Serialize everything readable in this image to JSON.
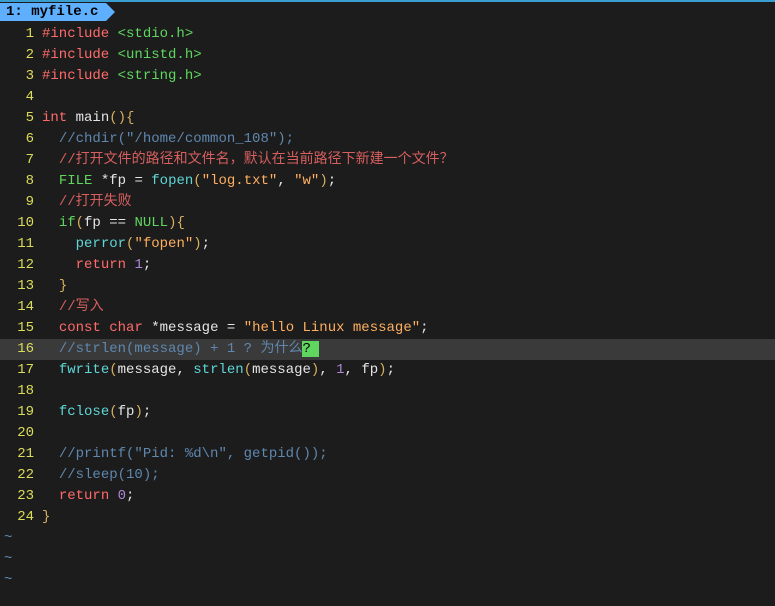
{
  "tab": {
    "label": " 1: myfile.c "
  },
  "lines": [
    {
      "n": 1,
      "tokens": [
        [
          "pp",
          "#include "
        ],
        [
          "hdr",
          "<stdio.h>"
        ]
      ]
    },
    {
      "n": 2,
      "tokens": [
        [
          "pp",
          "#include "
        ],
        [
          "hdr",
          "<unistd.h>"
        ]
      ]
    },
    {
      "n": 3,
      "tokens": [
        [
          "pp",
          "#include "
        ],
        [
          "hdr",
          "<string.h>"
        ]
      ]
    },
    {
      "n": 4,
      "tokens": []
    },
    {
      "n": 5,
      "tokens": [
        [
          "kw",
          "int"
        ],
        [
          "id",
          " main"
        ],
        [
          "pn",
          "(){"
        ]
      ]
    },
    {
      "n": 6,
      "tokens": [
        [
          "id",
          "  "
        ],
        [
          "cm",
          "//chdir(\"/home/common_108\");"
        ]
      ]
    },
    {
      "n": 7,
      "tokens": [
        [
          "id",
          "  "
        ],
        [
          "cmcn",
          "//打开文件的路径和文件名，默认在当前路径下新建一个文件？"
        ]
      ]
    },
    {
      "n": 8,
      "tokens": [
        [
          "id",
          "  "
        ],
        [
          "ty",
          "FILE"
        ],
        [
          "id",
          " "
        ],
        [
          "op",
          "*"
        ],
        [
          "id",
          "fp "
        ],
        [
          "op",
          "="
        ],
        [
          "id",
          " "
        ],
        [
          "fn",
          "fopen"
        ],
        [
          "pn",
          "("
        ],
        [
          "str",
          "\"log.txt\""
        ],
        [
          "op",
          ", "
        ],
        [
          "str",
          "\"w\""
        ],
        [
          "pn",
          ")"
        ],
        [
          "op",
          ";"
        ]
      ]
    },
    {
      "n": 9,
      "tokens": [
        [
          "id",
          "  "
        ],
        [
          "cmcn",
          "//打开失败"
        ]
      ]
    },
    {
      "n": 10,
      "tokens": [
        [
          "id",
          "  "
        ],
        [
          "kwg",
          "if"
        ],
        [
          "pn",
          "("
        ],
        [
          "id",
          "fp "
        ],
        [
          "op",
          "=="
        ],
        [
          "id",
          " "
        ],
        [
          "ty",
          "NULL"
        ],
        [
          "pn",
          "){"
        ]
      ]
    },
    {
      "n": 11,
      "tokens": [
        [
          "id",
          "    "
        ],
        [
          "fn",
          "perror"
        ],
        [
          "pn",
          "("
        ],
        [
          "str",
          "\"fopen\""
        ],
        [
          "pn",
          ")"
        ],
        [
          "op",
          ";"
        ]
      ]
    },
    {
      "n": 12,
      "tokens": [
        [
          "id",
          "    "
        ],
        [
          "kw",
          "return"
        ],
        [
          "id",
          " "
        ],
        [
          "num",
          "1"
        ],
        [
          "op",
          ";"
        ]
      ]
    },
    {
      "n": 13,
      "tokens": [
        [
          "id",
          "  "
        ],
        [
          "pn",
          "}"
        ]
      ]
    },
    {
      "n": 14,
      "tokens": [
        [
          "id",
          "  "
        ],
        [
          "cmcn",
          "//写入"
        ]
      ]
    },
    {
      "n": 15,
      "tokens": [
        [
          "id",
          "  "
        ],
        [
          "kw",
          "const"
        ],
        [
          "id",
          " "
        ],
        [
          "kw",
          "char"
        ],
        [
          "id",
          " "
        ],
        [
          "op",
          "*"
        ],
        [
          "id",
          "message "
        ],
        [
          "op",
          "="
        ],
        [
          "id",
          " "
        ],
        [
          "str",
          "\"hello Linux message\""
        ],
        [
          "op",
          ";"
        ]
      ]
    },
    {
      "n": 16,
      "current": true,
      "tokens": [
        [
          "id",
          "  "
        ],
        [
          "cm",
          "//strlen(message) + 1 ? 为什么"
        ],
        [
          "cur-hl",
          "? "
        ]
      ]
    },
    {
      "n": 17,
      "tokens": [
        [
          "id",
          "  "
        ],
        [
          "fn",
          "fwrite"
        ],
        [
          "pn",
          "("
        ],
        [
          "id",
          "message"
        ],
        [
          "op",
          ", "
        ],
        [
          "fn",
          "strlen"
        ],
        [
          "pn",
          "("
        ],
        [
          "id",
          "message"
        ],
        [
          "pn",
          ")"
        ],
        [
          "op",
          ", "
        ],
        [
          "num",
          "1"
        ],
        [
          "op",
          ", "
        ],
        [
          "id",
          "fp"
        ],
        [
          "pn",
          ")"
        ],
        [
          "op",
          ";"
        ]
      ]
    },
    {
      "n": 18,
      "tokens": []
    },
    {
      "n": 19,
      "tokens": [
        [
          "id",
          "  "
        ],
        [
          "fn",
          "fclose"
        ],
        [
          "pn",
          "("
        ],
        [
          "id",
          "fp"
        ],
        [
          "pn",
          ")"
        ],
        [
          "op",
          ";"
        ]
      ]
    },
    {
      "n": 20,
      "tokens": []
    },
    {
      "n": 21,
      "tokens": [
        [
          "id",
          "  "
        ],
        [
          "cm",
          "//printf(\"Pid: %d\\n\", getpid());"
        ]
      ]
    },
    {
      "n": 22,
      "tokens": [
        [
          "id",
          "  "
        ],
        [
          "cm",
          "//sleep(10);"
        ]
      ]
    },
    {
      "n": 23,
      "tokens": [
        [
          "id",
          "  "
        ],
        [
          "kw",
          "return"
        ],
        [
          "id",
          " "
        ],
        [
          "num",
          "0"
        ],
        [
          "op",
          ";"
        ]
      ]
    },
    {
      "n": 24,
      "tokens": [
        [
          "pn",
          "}"
        ]
      ]
    }
  ],
  "tilde": "~",
  "tilde_count": 3
}
